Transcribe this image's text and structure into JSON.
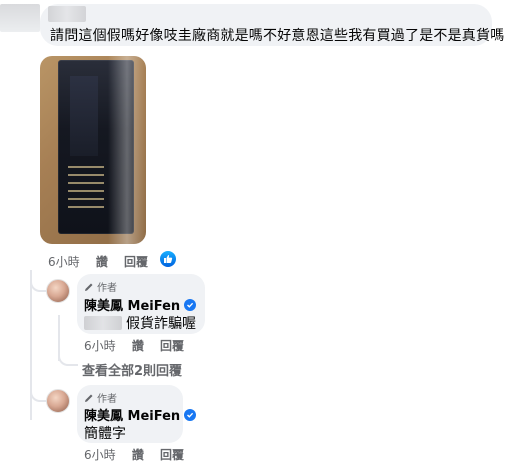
{
  "main_comment": {
    "text": "請問這個假嗎好像吱圭廠商就是嗎不好意恩這些我有買過了是不是真貨嗎",
    "time": "6小時",
    "like_label": "讚",
    "reply_label": "回覆"
  },
  "replies": [
    {
      "author_tag": "作者",
      "name": "陳美鳳 MeiFen",
      "text": "假貨詐騙喔",
      "time": "6小時",
      "like_label": "讚",
      "reply_label": "回覆"
    },
    {
      "author_tag": "作者",
      "name": "陳美鳳 MeiFen",
      "text": "簡體字",
      "time": "6小時",
      "like_label": "讚",
      "reply_label": "回覆"
    }
  ],
  "view_more": "查看全部2則回覆",
  "colors": {
    "bubble": "#f0f2f5",
    "meta": "#65676b",
    "verified": "#1877f2",
    "like": "#0062df"
  }
}
